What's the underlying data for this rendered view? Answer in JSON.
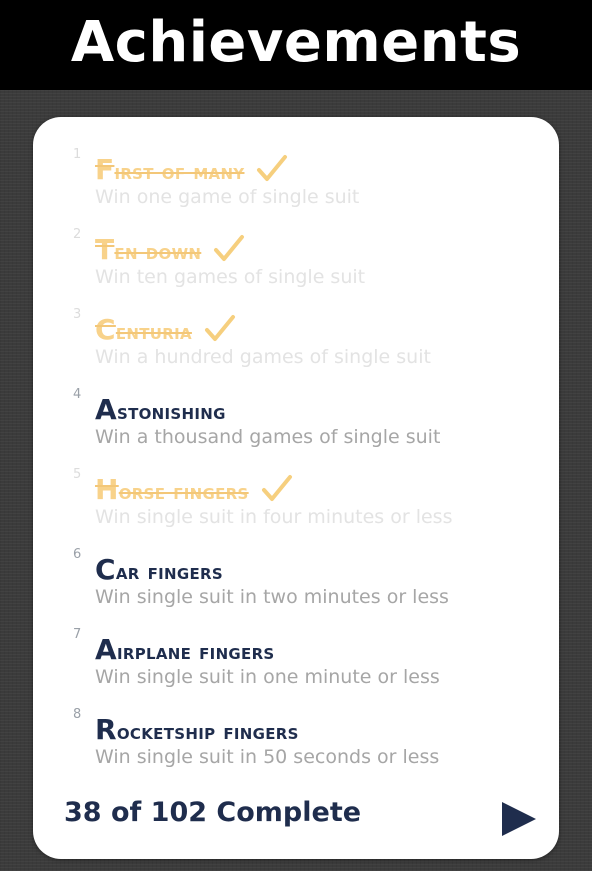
{
  "header": {
    "title": "Achievements"
  },
  "colors": {
    "header_bg": "#000000",
    "card_bg": "#ffffff",
    "title_active": "#1f2d4d",
    "title_completed": "#f8d28a",
    "description": "#a6a6a6",
    "checkmark": "#f6cf7e",
    "accent": "#1f2d4d"
  },
  "achievements": [
    {
      "number": "1",
      "title": "First of many",
      "description": "Win one game of single suit",
      "completed": true,
      "icon": "checkmark-icon"
    },
    {
      "number": "2",
      "title": "Ten down",
      "description": "Win ten games of single suit",
      "completed": true,
      "icon": "checkmark-icon"
    },
    {
      "number": "3",
      "title": "Centuria",
      "description": "Win a hundred games of single suit",
      "completed": true,
      "icon": "checkmark-icon"
    },
    {
      "number": "4",
      "title": "Astonishing",
      "description": "Win a thousand games of single suit",
      "completed": false
    },
    {
      "number": "5",
      "title": "Horse fingers",
      "description": "Win single suit in four minutes or less",
      "completed": true,
      "icon": "checkmark-icon"
    },
    {
      "number": "6",
      "title": "Car fingers",
      "description": "Win single suit in two minutes or less",
      "completed": false
    },
    {
      "number": "7",
      "title": "Airplane fingers",
      "description": "Win single suit in one minute or less",
      "completed": false
    },
    {
      "number": "8",
      "title": "Rocketship fingers",
      "description": "Win single suit in 50 seconds or less",
      "completed": false
    }
  ],
  "footer": {
    "progress_text": "38 of 102 Complete",
    "next_icon": "play-triangle-icon"
  }
}
